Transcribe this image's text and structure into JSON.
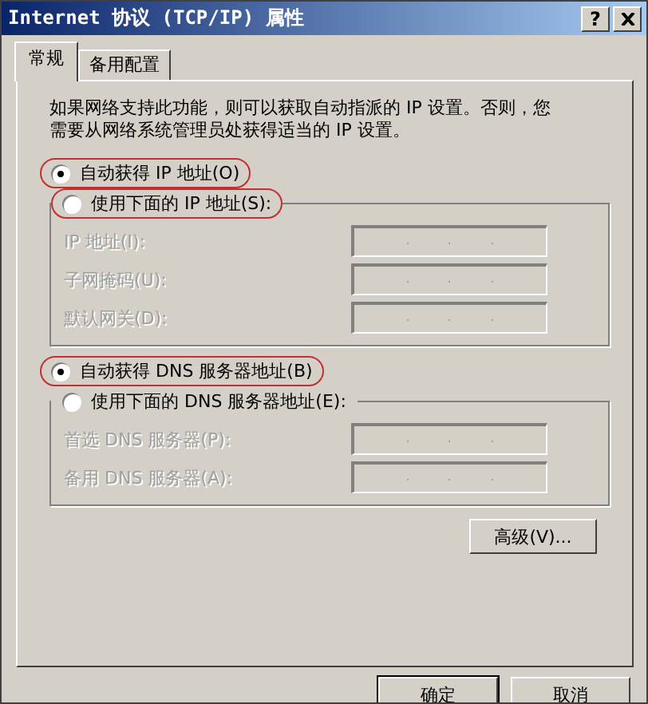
{
  "window": {
    "title": "Internet 协议 (TCP/IP) 属性",
    "help_button": "?"
  },
  "tabs": [
    {
      "label": "常规",
      "selected": true
    },
    {
      "label": "备用配置",
      "selected": false
    }
  ],
  "intro": "如果网络支持此功能，则可以获取自动指派的 IP 设置。否则，您需要从网络系统管理员处获得适当的 IP 设置。",
  "ip": {
    "options": [
      {
        "label": "自动获得 IP 地址(O)",
        "selected": true,
        "annotated": true
      },
      {
        "label": "使用下面的 IP 地址(S):",
        "selected": false,
        "annotated": true
      }
    ],
    "fields": [
      {
        "label": "IP 地址(I):",
        "disabled": true
      },
      {
        "label": "子网掩码(U):",
        "disabled": true
      },
      {
        "label": "默认网关(D):",
        "disabled": true
      }
    ]
  },
  "dns": {
    "options": [
      {
        "label": "自动获得 DNS 服务器地址(B)",
        "selected": true,
        "annotated": true
      },
      {
        "label": "使用下面的 DNS 服务器地址(E):",
        "selected": false,
        "annotated": false
      }
    ],
    "fields": [
      {
        "label": "首选 DNS 服务器(P):",
        "disabled": true
      },
      {
        "label": "备用 DNS 服务器(A):",
        "disabled": true
      }
    ]
  },
  "advanced_button": "高级(V)...",
  "buttons": [
    {
      "label": "确定",
      "default": true
    },
    {
      "label": "取消",
      "default": false
    }
  ]
}
